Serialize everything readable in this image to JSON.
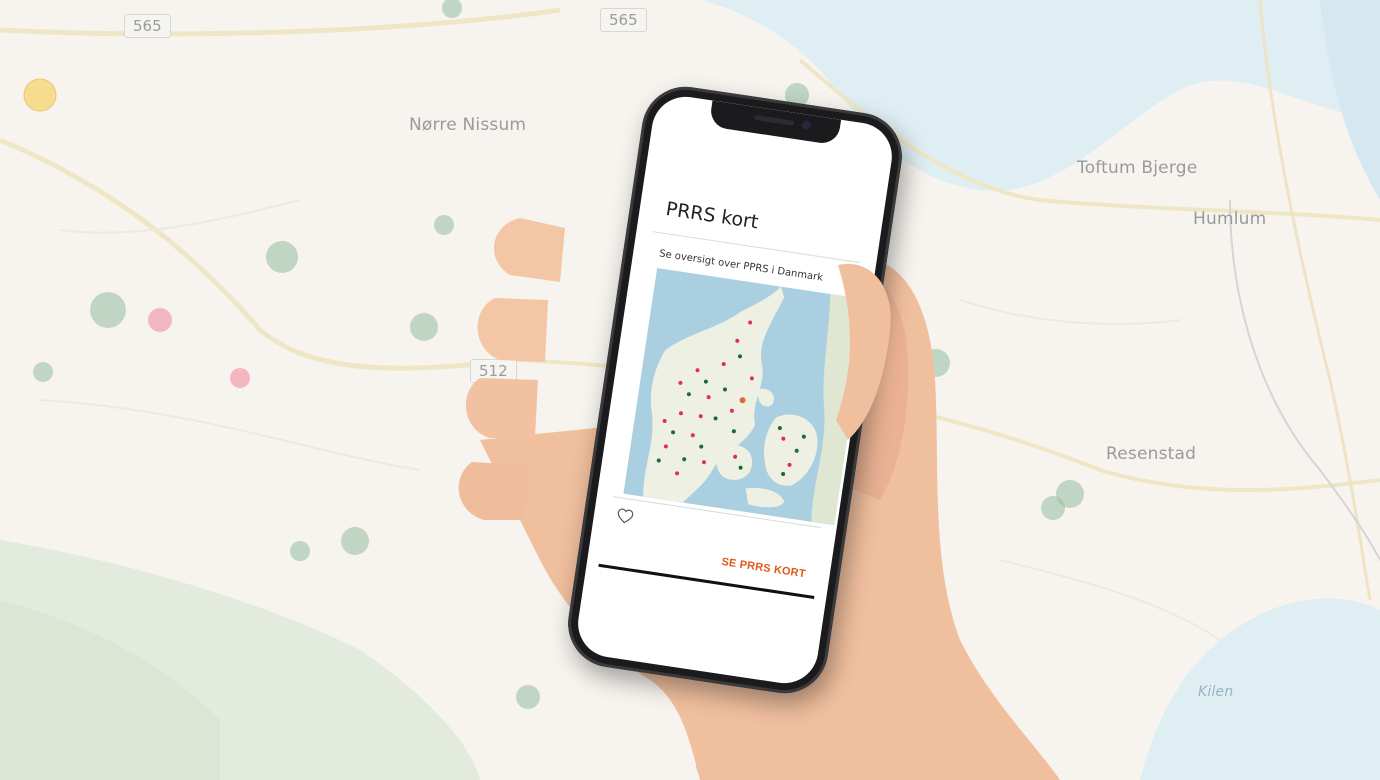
{
  "background_map": {
    "place_labels": [
      "Nørre Nissum",
      "Toftum Bjerge",
      "Humlum",
      "Resenstad"
    ],
    "water_label": "Kilen",
    "road_shields": [
      "565",
      "565",
      "512"
    ]
  },
  "phone_app": {
    "title": "PRRS kort",
    "subtitle": "Se oversigt over PPRS i Danmark",
    "cta_label": "SE PRRS KORT",
    "like_icon": "heart-outline-icon"
  },
  "colors": {
    "accent": "#e4571a",
    "marker_red": "#e0314c",
    "marker_green": "#1b6b38",
    "marker_orange": "#d96a2a"
  }
}
